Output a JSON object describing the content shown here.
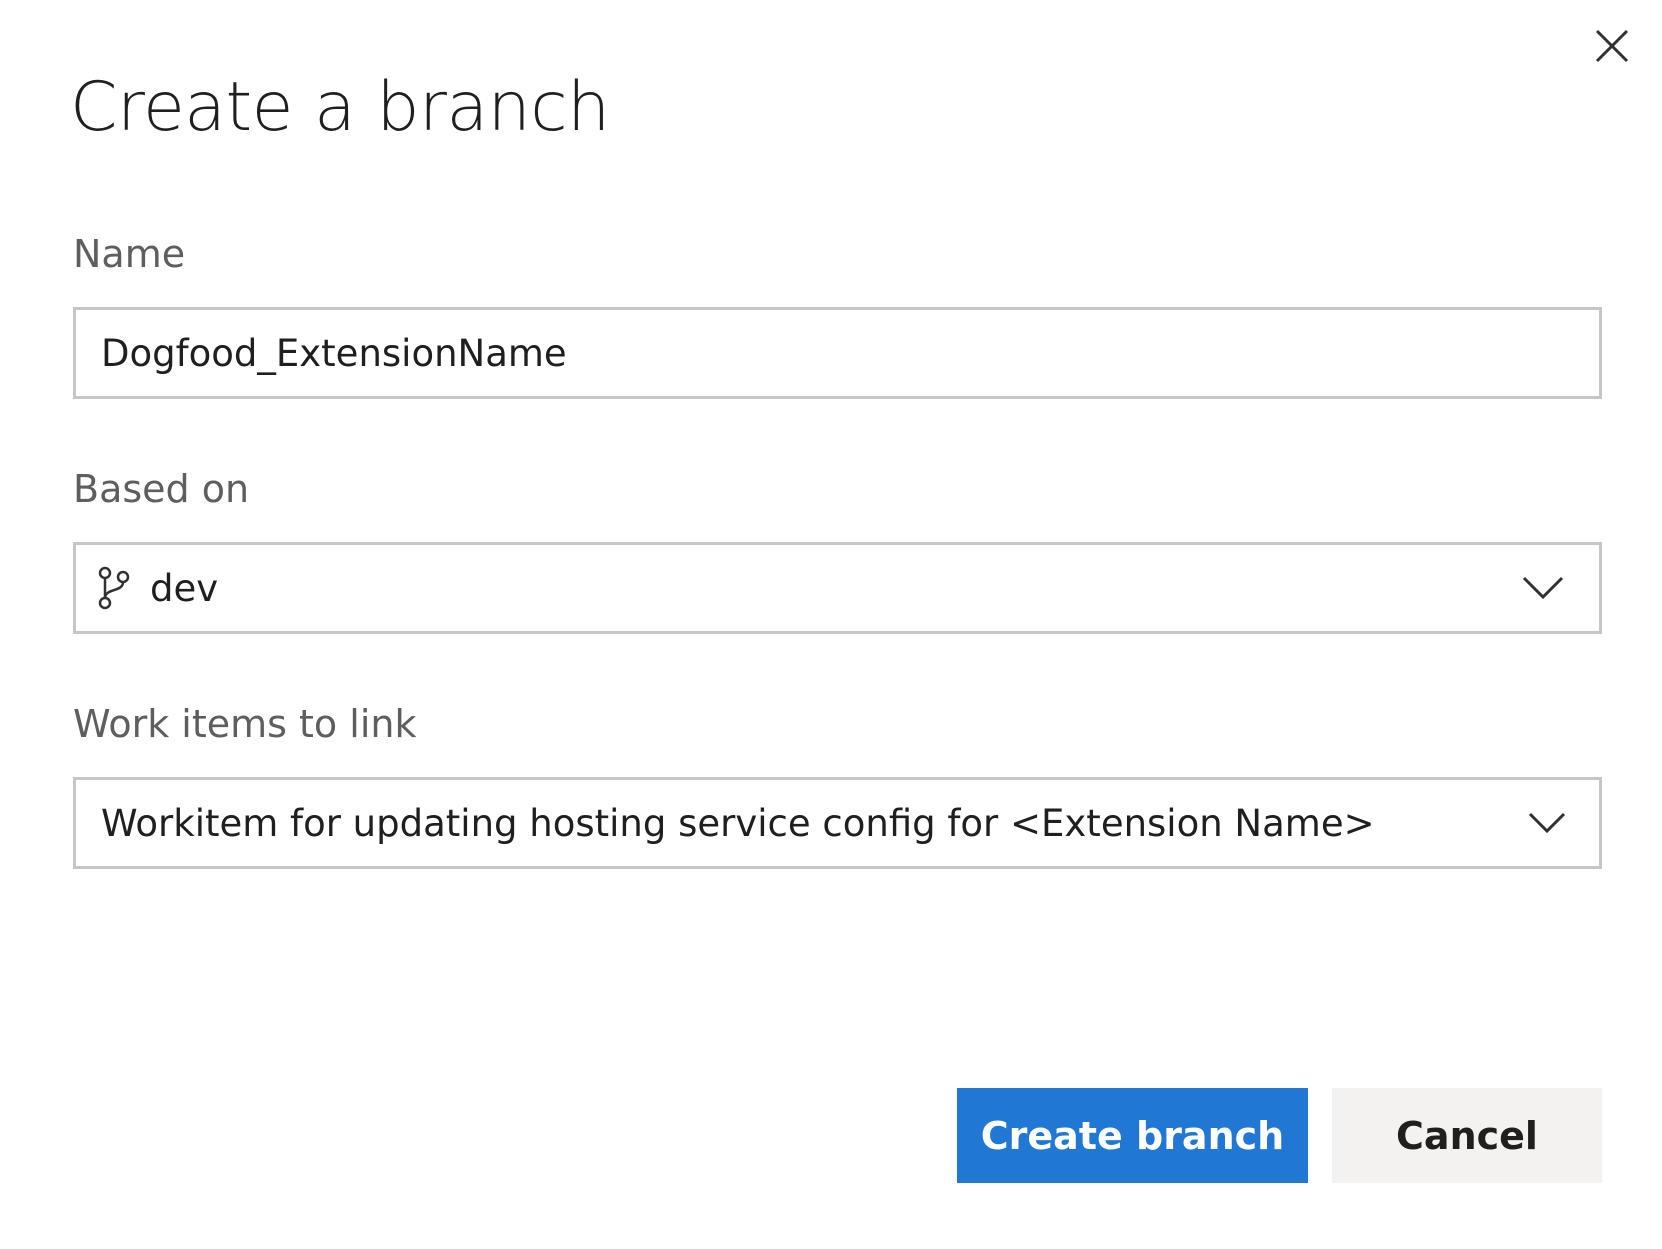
{
  "dialog": {
    "title": "Create a branch",
    "close_icon": "close-icon"
  },
  "fields": {
    "name": {
      "label": "Name",
      "value": "Dogfood_ExtensionName"
    },
    "based_on": {
      "label": "Based on",
      "value": "dev",
      "icon": "branch-icon",
      "dropdown_icon": "chevron-down-icon"
    },
    "work_items": {
      "label": "Work items to link",
      "value": "Workitem for updating hosting service config for <Extension Name>",
      "dropdown_icon": "chevron-down-icon"
    }
  },
  "actions": {
    "create_label": "Create branch",
    "cancel_label": "Cancel"
  },
  "colors": {
    "primary": "#2078d4",
    "secondary_bg": "#f3f2f1",
    "border": "#c8c6c4",
    "label_text": "#605e5c",
    "text": "#201f1e"
  }
}
